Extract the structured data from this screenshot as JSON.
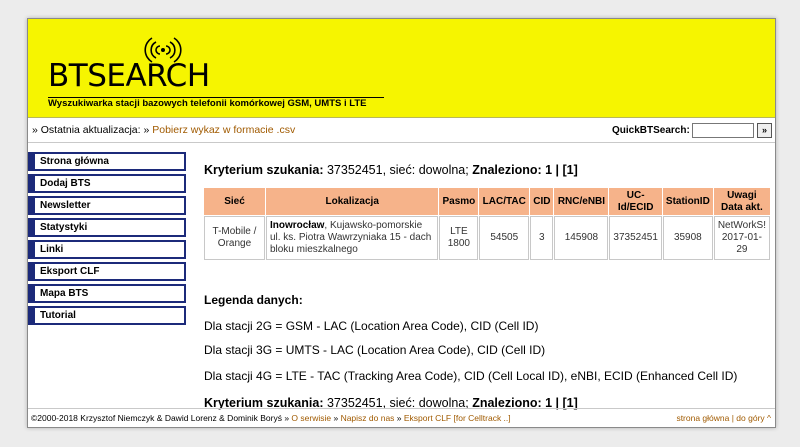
{
  "header": {
    "logo_text": "BTSEARCH",
    "tagline": "Wyszukiwarka stacji bazowych telefonii komórkowej GSM, UMTS i LTE"
  },
  "infobar": {
    "update_prefix": "» Ostatnia aktualizacja: » ",
    "download_link": "Pobierz wykaz w formacie .csv",
    "quicksearch_label": "QuickBTSearch:",
    "quicksearch_value": "",
    "quicksearch_button": "»"
  },
  "sidebar": {
    "items": [
      {
        "label": "Strona główna"
      },
      {
        "label": "Dodaj BTS"
      },
      {
        "label": "Newsletter"
      },
      {
        "label": "Statystyki"
      },
      {
        "label": "Linki"
      },
      {
        "label": "Eksport CLF"
      },
      {
        "label": "Mapa BTS"
      },
      {
        "label": "Tutorial"
      }
    ]
  },
  "search": {
    "label": "Kryterium szukania:",
    "value": " 37352451, sieć: dowolna; ",
    "found": "Znaleziono: 1 | [1]"
  },
  "table": {
    "headers": [
      "Sieć",
      "Lokalizacja",
      "Pasmo",
      "LAC/TAC",
      "CID",
      "RNC/eNBI",
      "UC-Id/ECID",
      "StationID",
      "Uwagi Data akt."
    ],
    "rows": [
      {
        "network": "T-Mobile / Orange",
        "city": "Inowrocław",
        "location_rest": ", Kujawsko-pomorskie ul. ks. Piotra Wawrzyniaka 15 - dach bloku mieszkalnego",
        "band": "LTE 1800",
        "lac": "54505",
        "cid": "3",
        "rnc": "145908",
        "ucid": "37352451",
        "station_id": "35908",
        "notes": "NetWorkS! 2017-01-29"
      }
    ]
  },
  "legend": {
    "title": "Legenda danych:",
    "lines": [
      "Dla stacji 2G = GSM - LAC (Location Area Code), CID (Cell ID)",
      "Dla stacji 3G = UMTS - LAC (Location Area Code), CID (Cell ID)",
      "Dla stacji 4G = LTE - TAC (Tracking Area Code), CID (Cell Local ID), eNBI, ECID (Enhanced Cell ID)"
    ]
  },
  "footer": {
    "copyright": "©2000-2018 Krzysztof Niemczyk & Dawid Lorenz & Dominik Boryś » ",
    "links": [
      "O serwisie",
      "Napisz do nas",
      "Eksport CLF [for Celltrack ..]"
    ],
    "right_home": "strona główna",
    "right_top": "do góry ^"
  }
}
